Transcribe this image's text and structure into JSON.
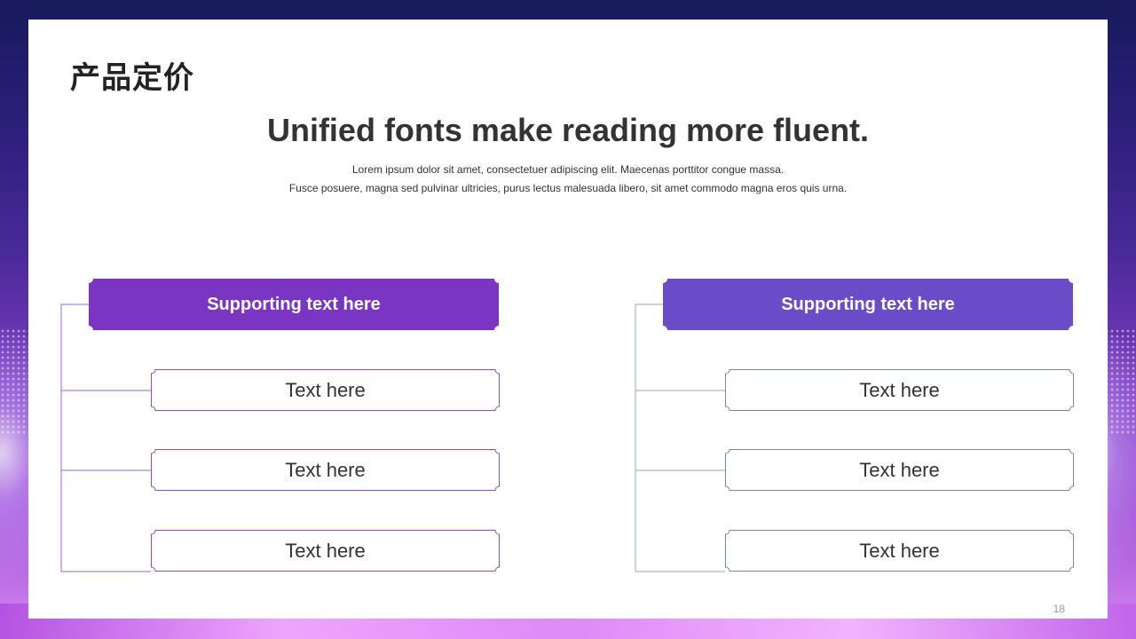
{
  "page": {
    "title": "产品定价",
    "headline": "Unified fonts make reading more fluent.",
    "subtitle_line1": "Lorem ipsum dolor sit amet, consectetuer adipiscing elit. Maecenas porttitor congue massa.",
    "subtitle_line2": "Fusce posuere, magna sed pulvinar ultricies, purus lectus malesuada libero, sit amet commodo magna eros quis urna.",
    "page_number": "18"
  },
  "colors": {
    "left_header": "#7a36c2",
    "right_header": "#6a4cc8",
    "left_outline": "#8a4ad0",
    "right_outline": "#7a8899",
    "connector_left": "#9a66d4",
    "connector_right": "#9aa4b4"
  },
  "groups": [
    {
      "header": "Supporting text here",
      "items": [
        "Text here",
        "Text here",
        "Text here"
      ]
    },
    {
      "header": "Supporting text here",
      "items": [
        "Text here",
        "Text here",
        "Text here"
      ]
    }
  ]
}
